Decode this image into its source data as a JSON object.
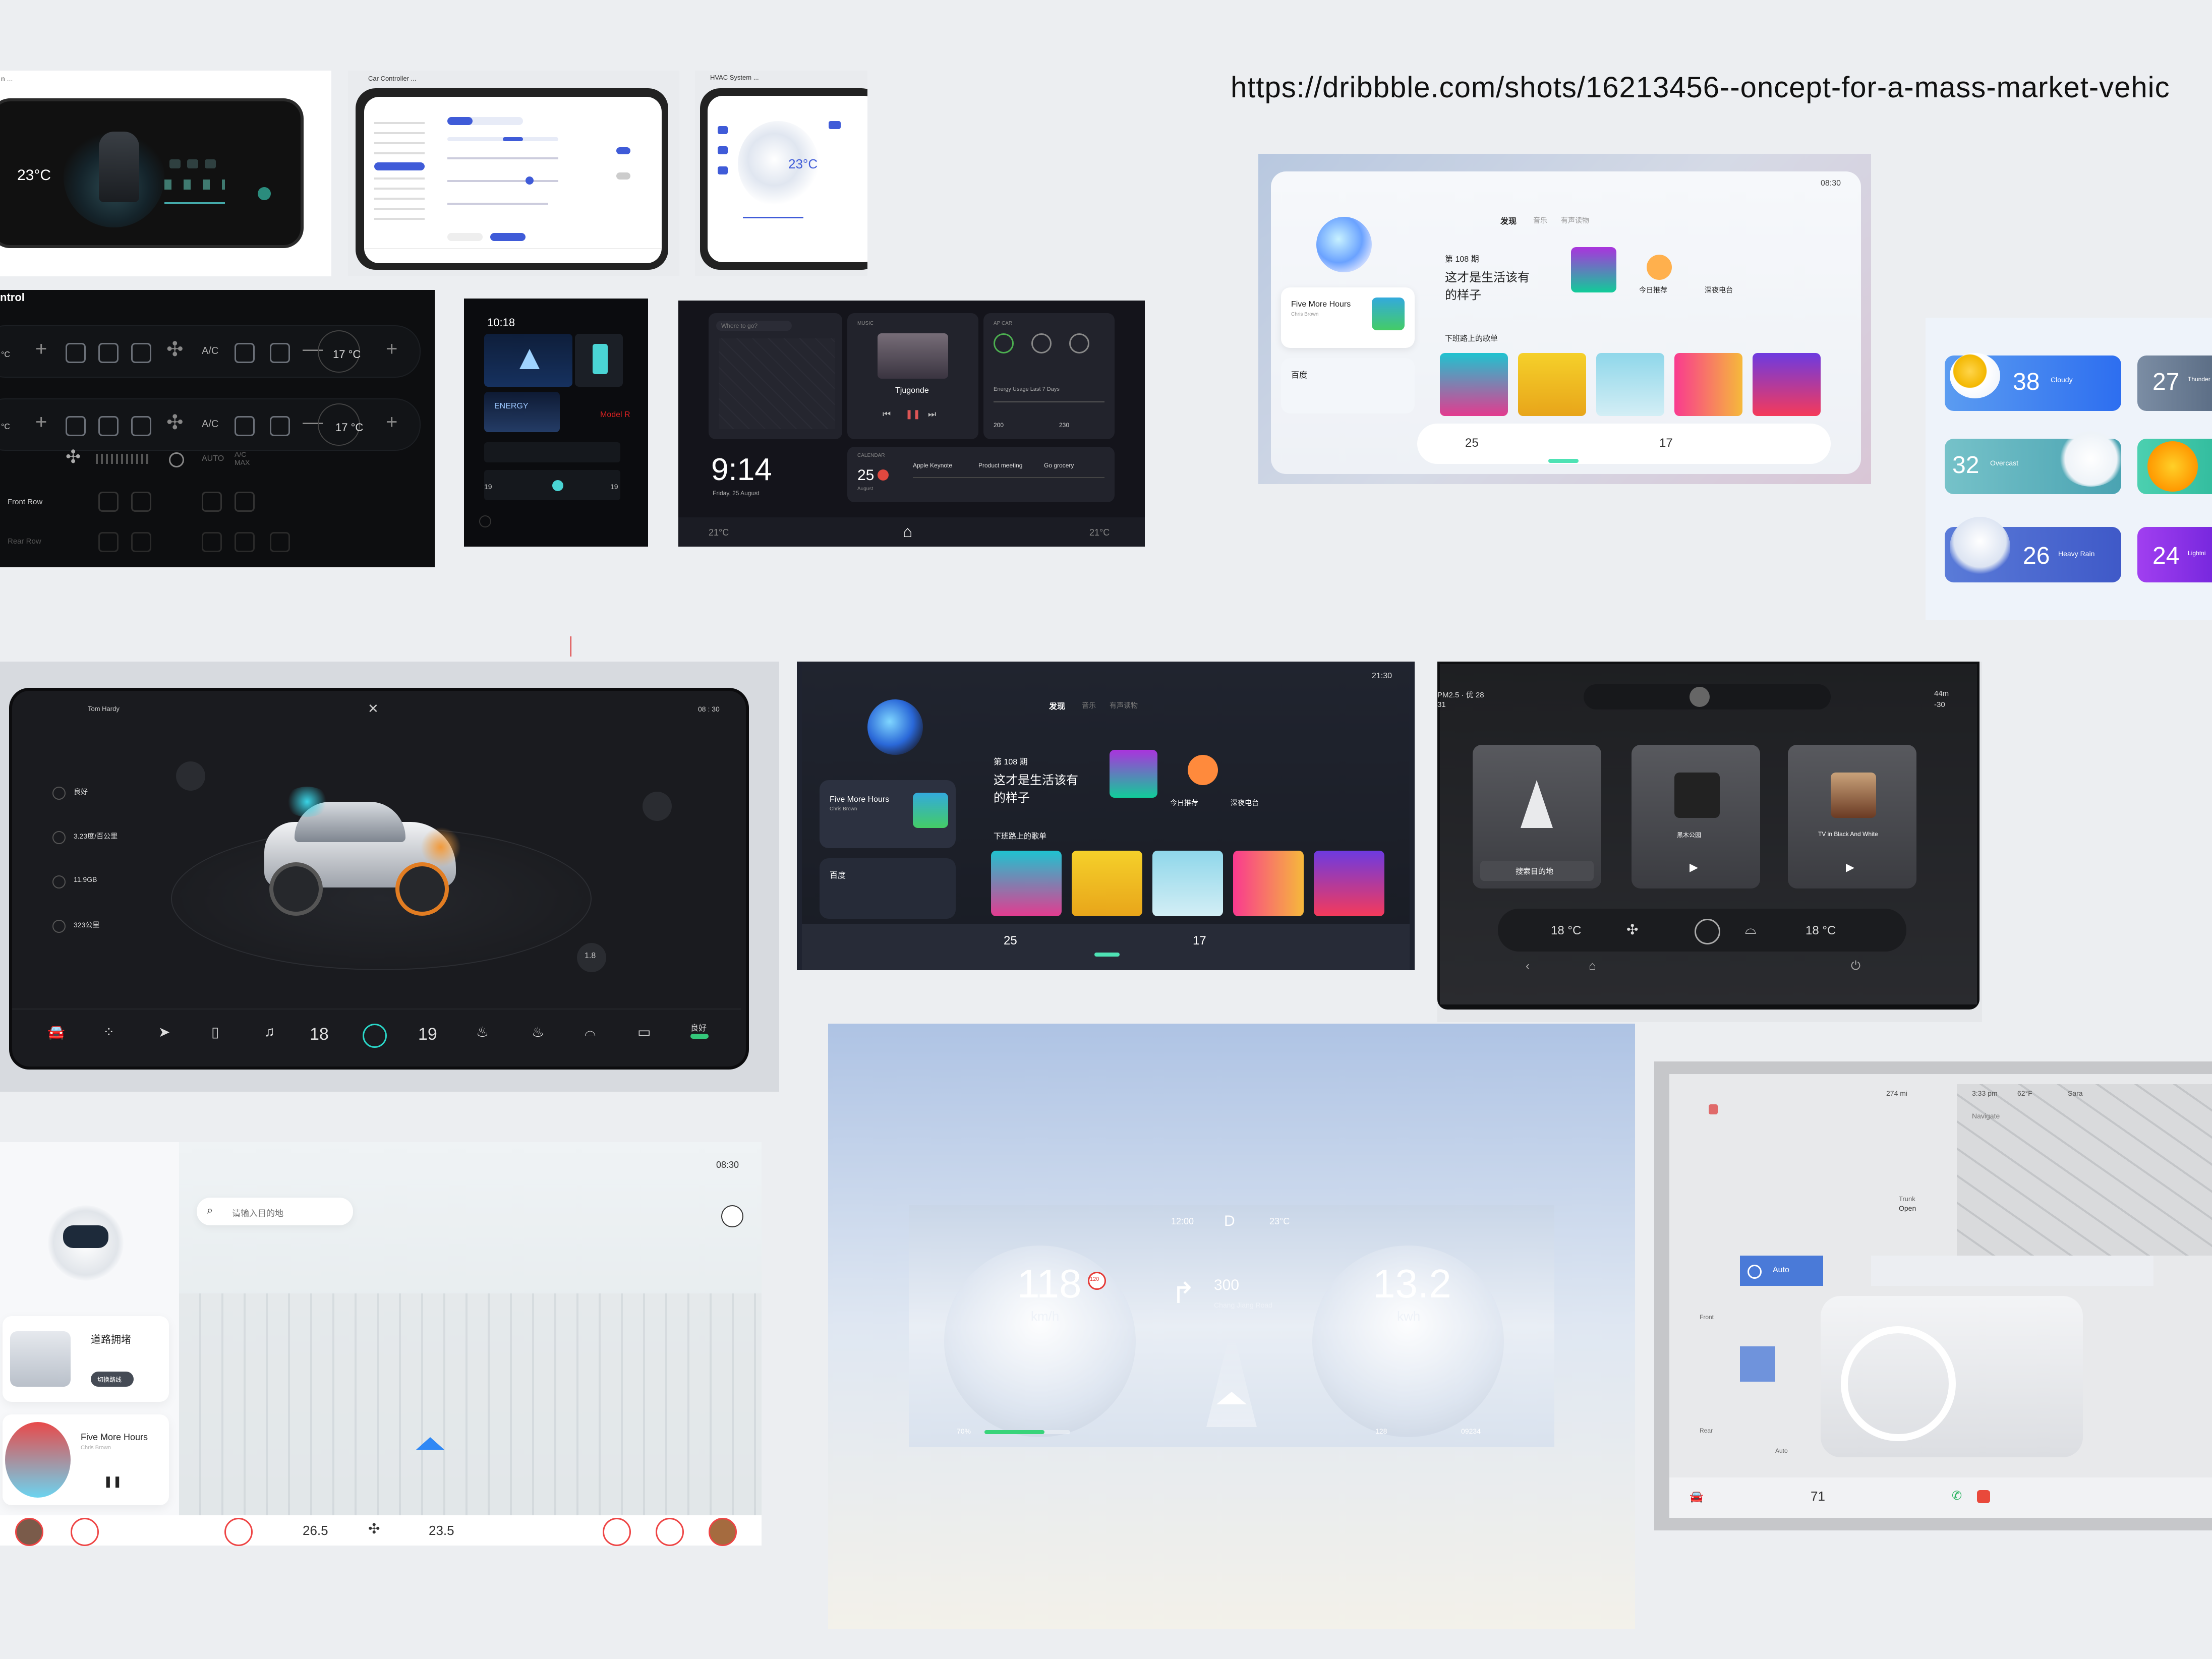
{
  "url": "https://dribbble.com/shots/16213456--oncept-for-a-mass-market-vehic",
  "hvac_dark": {
    "title": "n ...",
    "temp": "23°C"
  },
  "car_controller": {
    "title": "Car Controller ..."
  },
  "hvac_system": {
    "title": "HVAC System ...",
    "temp": "23°C"
  },
  "control_dark": {
    "title": "ntrol",
    "ac_label": "A/C",
    "ac_label2": "A/C",
    "temp_left_top": "°C",
    "temp_right_top": "17 °C",
    "temp_left_mid": "°C",
    "temp_right_mid": "17 °C",
    "auto": "AUTO",
    "max": "A/C MAX",
    "front_row": "Front Row",
    "rear_row": "Rear Row"
  },
  "vertical_phone": {
    "time": "10:18",
    "energy": "ENERGY",
    "caption": "Model R",
    "temp": "19",
    "temp2": "19"
  },
  "dash_914": {
    "time": "9:14",
    "date": "Friday, 25 August",
    "where": "Where to go?",
    "music": "MUSIC",
    "song": "Tjugonde",
    "ap": "AP CAR",
    "energy_usage": "Energy Usage Last 7 Days",
    "calendar": "CALENDAR",
    "day": "25",
    "month": "August",
    "events": [
      "Apple Keynote",
      "Product meeting",
      "Go grocery"
    ],
    "val1": "200",
    "val2": "230",
    "temp_left": "21°C",
    "temp_right": "21°C"
  },
  "light_music": {
    "time": "08:30",
    "tabs": [
      "发现",
      "音乐",
      "有声读物"
    ],
    "issue": "第 108 期",
    "headline": "这才是生活该有的样子",
    "playlist": "下班路上的歌单",
    "now_playing": "Five More Hours",
    "artist": "Chris Brown",
    "baidu": "百度",
    "recommend": "今日推荐",
    "radio": "深夜电台",
    "temp_left": "25",
    "temp_right": "17"
  },
  "weather": {
    "cards": [
      {
        "temp": "38",
        "label": "Cloudy"
      },
      {
        "temp": "27",
        "label": "Thunder"
      },
      {
        "temp": "32",
        "label": "Overcast"
      },
      {
        "temp": "",
        "label": ""
      },
      {
        "temp": "26",
        "label": "Heavy Rain"
      },
      {
        "temp": "24",
        "label": "Lightni"
      }
    ]
  },
  "car_status": {
    "user": "Tom Hardy",
    "time": "08 : 30",
    "status_items": [
      "良好",
      "3.23度/百公里",
      "11.9GB",
      "323公里"
    ],
    "badge": "1.8",
    "temp_left": "18",
    "temp_right": "19",
    "mode": "良好"
  },
  "dark_music": {
    "time": "21:30",
    "tabs": [
      "发现",
      "音乐",
      "有声读物"
    ],
    "issue": "第 108 期",
    "headline": "这才是生活该有的样子",
    "playlist": "下班路上的歌单",
    "now_playing": "Five More Hours",
    "artist": "Chris Brown",
    "baidu": "百度",
    "recommend": "今日推荐",
    "radio": "深夜电台",
    "temp_left": "25",
    "temp_right": "17"
  },
  "nav_screen": {
    "aqi": "PM2.5 · 优 28",
    "num": "31",
    "range": "44m",
    "temp": "-30",
    "search": "搜索目的地",
    "track1": "黑木公园",
    "track2": "TV in Black And White",
    "temp_left": "18 °C",
    "temp_right": "18 °C"
  },
  "map_screen": {
    "time": "08:30",
    "search_placeholder": "请输入目的地",
    "traffic": "道路拥堵",
    "switch_route": "切换路线",
    "now_playing": "Five More Hours",
    "artist": "Chris Brown",
    "temp_left": "26.5",
    "temp_right": "23.5"
  },
  "cluster": {
    "time": "12:00",
    "gear": "D",
    "outside": "23°C",
    "speed": "118",
    "speed_unit": "km/h",
    "limit": "120",
    "distance": "300",
    "road": "Chang Jiang Road",
    "energy": "13.2",
    "energy_unit": "kwh",
    "battery": "70%",
    "battery_fill": 0.7,
    "trip": "128",
    "odo": "09234"
  },
  "tesla": {
    "range": "274 mi",
    "time": "3:33 pm",
    "temp": "62°F",
    "user": "Sara",
    "navigate": "Navigate",
    "trunk": "Trunk",
    "open": "Open",
    "auto": "Auto",
    "front": "Front",
    "rear": "Rear",
    "auto2": "Auto",
    "cabin_temp": "71"
  }
}
